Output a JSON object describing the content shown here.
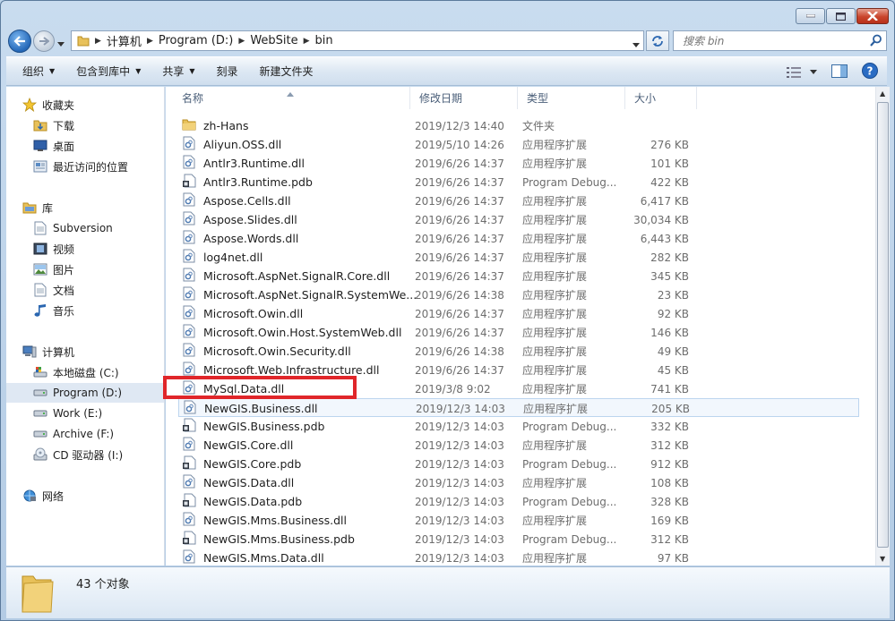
{
  "address": {
    "crumbs": [
      "计算机",
      "Program (D:)",
      "WebSite",
      "bin"
    ]
  },
  "search": {
    "placeholder": "搜索 bin"
  },
  "toolbar": {
    "organize": "组织",
    "include_in_library": "包含到库中",
    "share": "共享",
    "burn": "刻录",
    "new_folder": "新建文件夹"
  },
  "nav": {
    "favorites": "收藏夹",
    "downloads": "下载",
    "desktop": "桌面",
    "recent": "最近访问的位置",
    "libraries": "库",
    "subversion": "Subversion",
    "videos": "视频",
    "pictures": "图片",
    "documents": "文档",
    "music": "音乐",
    "computer": "计算机",
    "local_disk": "本地磁盘 (C:)",
    "program": "Program (D:)",
    "work": "Work (E:)",
    "archive": "Archive (F:)",
    "cd_drive": "CD 驱动器 (I:)",
    "network": "网络"
  },
  "columns": {
    "name": "名称",
    "date": "修改日期",
    "type": "类型",
    "size": "大小"
  },
  "files": [
    {
      "name": "zh-Hans",
      "date": "2019/12/3 14:40",
      "type": "文件夹",
      "size": "",
      "icon": "folder-icon"
    },
    {
      "name": "Aliyun.OSS.dll",
      "date": "2019/5/10 14:26",
      "type": "应用程序扩展",
      "size": "276 KB",
      "icon": "dll-icon"
    },
    {
      "name": "Antlr3.Runtime.dll",
      "date": "2019/6/26 14:37",
      "type": "应用程序扩展",
      "size": "101 KB",
      "icon": "dll-icon"
    },
    {
      "name": "Antlr3.Runtime.pdb",
      "date": "2019/6/26 14:37",
      "type": "Program Debug...",
      "size": "422 KB",
      "icon": "pdb-icon"
    },
    {
      "name": "Aspose.Cells.dll",
      "date": "2019/6/26 14:37",
      "type": "应用程序扩展",
      "size": "6,417 KB",
      "icon": "dll-icon"
    },
    {
      "name": "Aspose.Slides.dll",
      "date": "2019/6/26 14:37",
      "type": "应用程序扩展",
      "size": "30,034 KB",
      "icon": "dll-icon"
    },
    {
      "name": "Aspose.Words.dll",
      "date": "2019/6/26 14:37",
      "type": "应用程序扩展",
      "size": "6,443 KB",
      "icon": "dll-icon"
    },
    {
      "name": "log4net.dll",
      "date": "2019/6/26 14:37",
      "type": "应用程序扩展",
      "size": "282 KB",
      "icon": "dll-icon"
    },
    {
      "name": "Microsoft.AspNet.SignalR.Core.dll",
      "date": "2019/6/26 14:37",
      "type": "应用程序扩展",
      "size": "345 KB",
      "icon": "dll-icon"
    },
    {
      "name": "Microsoft.AspNet.SignalR.SystemWe...",
      "date": "2019/6/26 14:38",
      "type": "应用程序扩展",
      "size": "23 KB",
      "icon": "dll-icon"
    },
    {
      "name": "Microsoft.Owin.dll",
      "date": "2019/6/26 14:37",
      "type": "应用程序扩展",
      "size": "92 KB",
      "icon": "dll-icon"
    },
    {
      "name": "Microsoft.Owin.Host.SystemWeb.dll",
      "date": "2019/6/26 14:37",
      "type": "应用程序扩展",
      "size": "146 KB",
      "icon": "dll-icon"
    },
    {
      "name": "Microsoft.Owin.Security.dll",
      "date": "2019/6/26 14:38",
      "type": "应用程序扩展",
      "size": "49 KB",
      "icon": "dll-icon"
    },
    {
      "name": "Microsoft.Web.Infrastructure.dll",
      "date": "2019/6/26 14:37",
      "type": "应用程序扩展",
      "size": "45 KB",
      "icon": "dll-icon"
    },
    {
      "name": "MySql.Data.dll",
      "date": "2019/3/8 9:02",
      "type": "应用程序扩展",
      "size": "741 KB",
      "icon": "dll-icon"
    },
    {
      "name": "NewGIS.Business.dll",
      "date": "2019/12/3 14:03",
      "type": "应用程序扩展",
      "size": "205 KB",
      "icon": "dll-icon"
    },
    {
      "name": "NewGIS.Business.pdb",
      "date": "2019/12/3 14:03",
      "type": "Program Debug...",
      "size": "332 KB",
      "icon": "pdb-icon"
    },
    {
      "name": "NewGIS.Core.dll",
      "date": "2019/12/3 14:03",
      "type": "应用程序扩展",
      "size": "312 KB",
      "icon": "dll-icon"
    },
    {
      "name": "NewGIS.Core.pdb",
      "date": "2019/12/3 14:03",
      "type": "Program Debug...",
      "size": "912 KB",
      "icon": "pdb-icon"
    },
    {
      "name": "NewGIS.Data.dll",
      "date": "2019/12/3 14:03",
      "type": "应用程序扩展",
      "size": "108 KB",
      "icon": "dll-icon"
    },
    {
      "name": "NewGIS.Data.pdb",
      "date": "2019/12/3 14:03",
      "type": "Program Debug...",
      "size": "328 KB",
      "icon": "pdb-icon"
    },
    {
      "name": "NewGIS.Mms.Business.dll",
      "date": "2019/12/3 14:03",
      "type": "应用程序扩展",
      "size": "169 KB",
      "icon": "dll-icon"
    },
    {
      "name": "NewGIS.Mms.Business.pdb",
      "date": "2019/12/3 14:03",
      "type": "Program Debug...",
      "size": "312 KB",
      "icon": "pdb-icon"
    },
    {
      "name": "NewGIS.Mms.Data.dll",
      "date": "2019/12/3 14:03",
      "type": "应用程序扩展",
      "size": "97 KB",
      "icon": "dll-icon"
    }
  ],
  "status": {
    "count": "43 个对象"
  },
  "colors": {
    "highlight": "#e0262a",
    "selection": "#dfe8f3"
  }
}
